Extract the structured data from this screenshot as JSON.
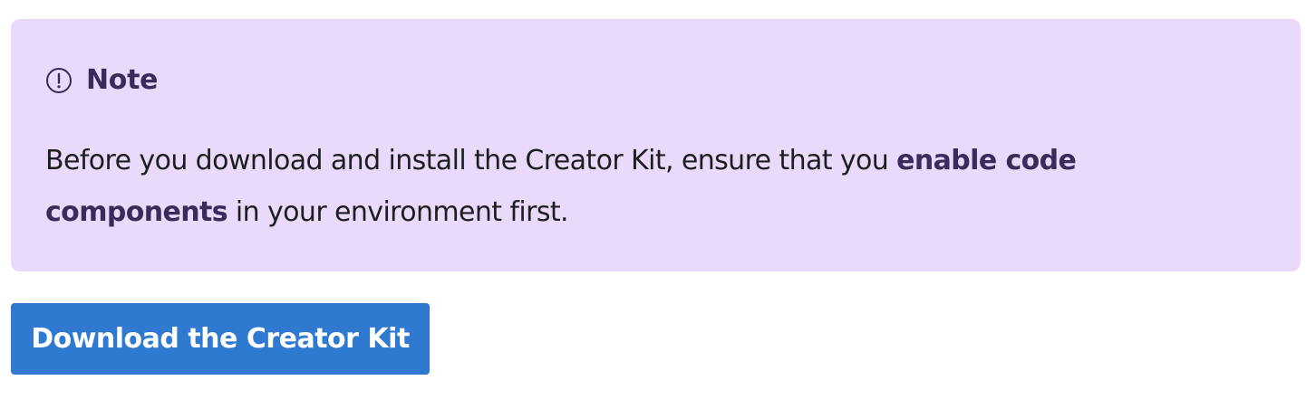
{
  "note": {
    "icon": "info-circle-icon",
    "title": "Note",
    "text_before": "Before you download and install the Creator Kit, ensure that you ",
    "link_text": "enable code components",
    "text_after": " in your environment first.",
    "background_color": "#e9dafb",
    "accent_color": "#3b2a5a"
  },
  "download_button": {
    "label": "Download the Creator Kit",
    "color": "#2f7ad0"
  }
}
